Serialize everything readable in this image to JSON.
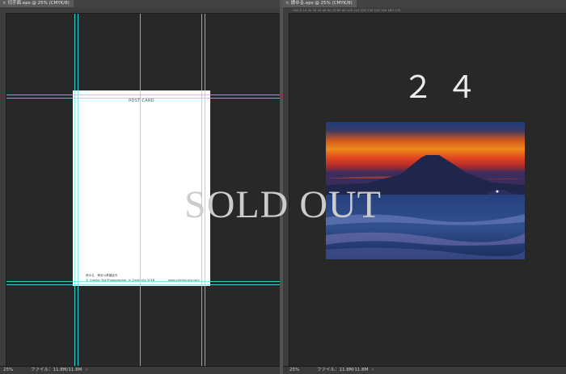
{
  "left_window": {
    "tab": {
      "close_glyph": "×",
      "title": "切手面.eps @ 25% (CMYK/8)"
    },
    "status": {
      "zoom": "25%",
      "file_info": "ファイル：11.8M/11.8M",
      "arrow": "›"
    },
    "postcard": {
      "title": "POST CARD",
      "caption": "燃ゆる　神奈川県鎌倉市",
      "credit": "© Yumiko Ota Photographer, in Zushi city 2018",
      "url": "www.yumiko-ota.com"
    }
  },
  "right_window": {
    "tab": {
      "close_glyph": "×",
      "title": "燃ゆる.eps @ 25% (CMYK/8)"
    },
    "status": {
      "zoom": "25%",
      "file_info": "ファイル：11.8M/11.8M",
      "arrow": "›"
    },
    "number": "２４",
    "ruler_ticks": "-100   0   10   20   30   40   50   60   70   80   90   100   110   120   130   140   150   160   170"
  },
  "overlay": {
    "text": "SOLD OUT",
    "color": "#cccccc"
  },
  "colors": {
    "guide": "#33d0d0",
    "panel_bg": "#282828",
    "separator": "#535353"
  }
}
